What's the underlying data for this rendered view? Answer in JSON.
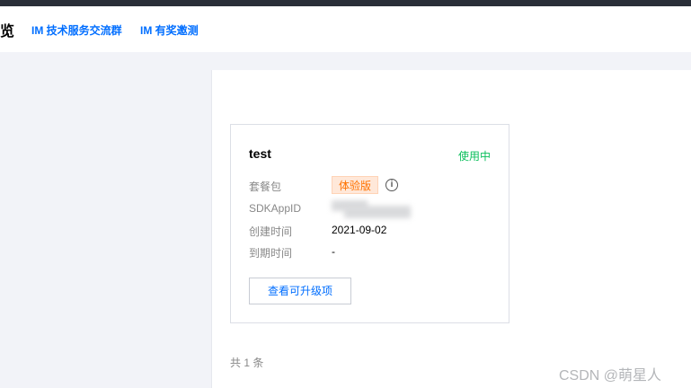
{
  "header": {
    "page_title": "览",
    "links": [
      "IM 技术服务交流群",
      "IM 有奖邀测"
    ]
  },
  "card": {
    "app_name": "test",
    "status": "使用中",
    "package_label": "套餐包",
    "package_value": "体验版",
    "sdkappid_label": "SDKAppID",
    "created_label": "创建时间",
    "created_value": "2021-09-02",
    "expire_label": "到期时间",
    "expire_value": "-",
    "upgrade_button": "查看可升级项"
  },
  "pagination": {
    "total": "共 1 条"
  },
  "watermark": "CSDN @萌星人",
  "colors": {
    "accent": "#006eff",
    "status_green": "#0abf5b",
    "badge_orange": "#ff7200",
    "topbar": "#292e38"
  }
}
